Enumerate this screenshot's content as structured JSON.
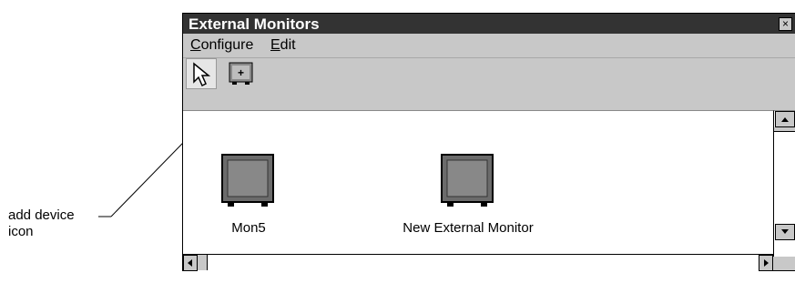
{
  "annotation": {
    "line1": "add device",
    "line2": "icon"
  },
  "window": {
    "title": "External Monitors",
    "close_glyph": "×"
  },
  "menu": [
    {
      "label": "Configure"
    },
    {
      "label": "Edit"
    }
  ],
  "toolbar": {
    "tools": [
      "arrow-pointer-icon",
      "add-device-icon"
    ],
    "add_glyph": "+"
  },
  "devices": [
    {
      "label": "Mon5"
    },
    {
      "label": "New External Monitor"
    }
  ],
  "icons": {
    "monitor": "monitor-icon",
    "scroll_up": "arrow-up-icon",
    "scroll_down": "arrow-down-icon",
    "scroll_left": "arrow-left-icon",
    "scroll_right": "arrow-right-icon"
  },
  "colors": {
    "titlebar": "#333333",
    "chrome": "#c8c8c8",
    "canvas": "#ffffff"
  }
}
